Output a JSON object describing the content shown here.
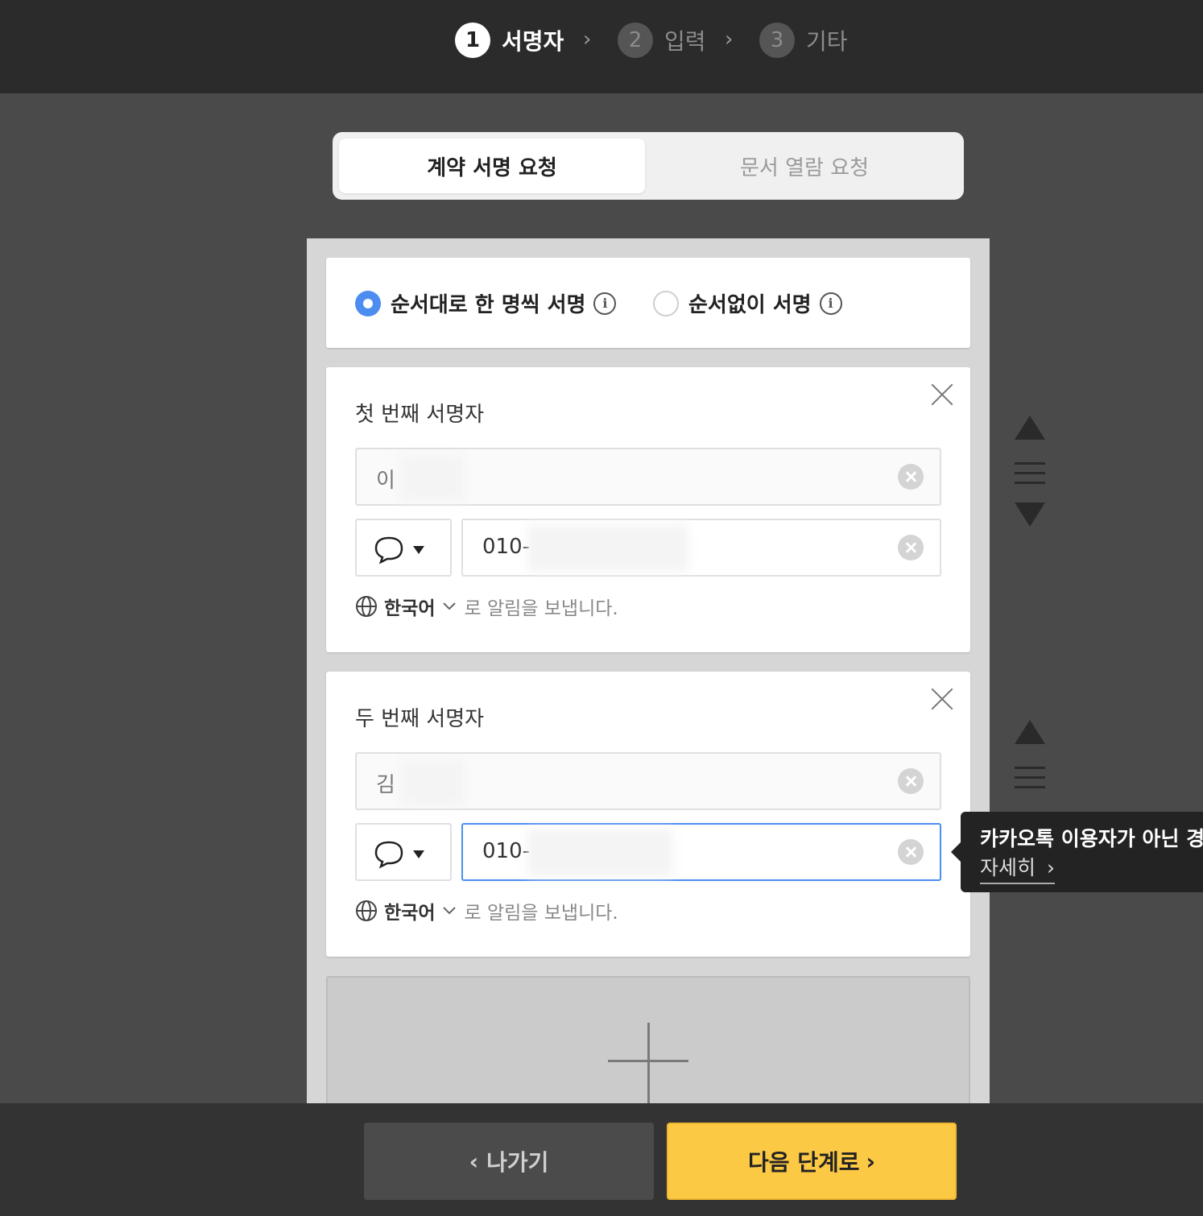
{
  "stepper": {
    "steps": [
      {
        "num": "1",
        "label": "서명자"
      },
      {
        "num": "2",
        "label": "입력"
      },
      {
        "num": "3",
        "label": "기타"
      }
    ]
  },
  "tabs": {
    "contract": "계약 서명 요청",
    "view": "문서 열람 요청"
  },
  "sign_order": {
    "sequential": "순서대로 한 명씩 서명",
    "parallel": "순서없이 서명",
    "selected": "sequential"
  },
  "signers": [
    {
      "title": "첫 번째 서명자",
      "name_value": "이",
      "phone_value": "010-",
      "language": "한국어",
      "notify_suffix": "로 알림을 보냅니다."
    },
    {
      "title": "두 번째 서명자",
      "name_value": "김",
      "phone_value": "010-",
      "language": "한국어",
      "notify_suffix": "로 알림을 보냅니다."
    }
  ],
  "tooltip": {
    "text": "카카오톡 이용자가 아닌 경",
    "link": "자세히"
  },
  "footer": {
    "exit": "나가기",
    "next": "다음 단계로"
  },
  "colors": {
    "accent_blue": "#4d8df0",
    "next_button": "#fcc945",
    "topbar": "#2b2b2b"
  }
}
